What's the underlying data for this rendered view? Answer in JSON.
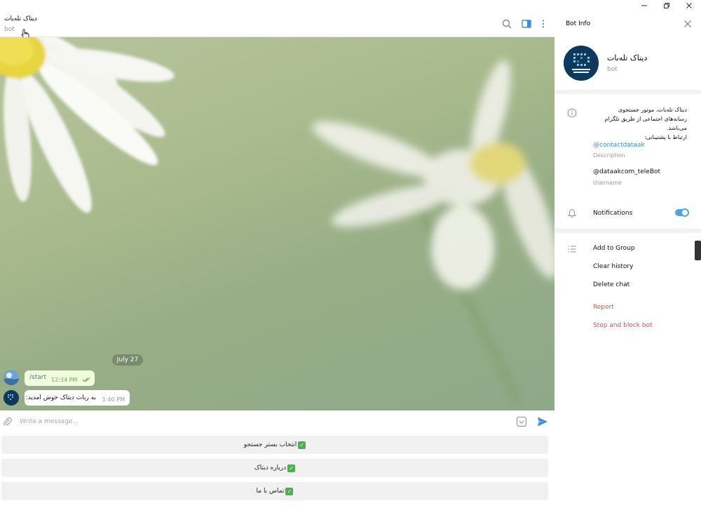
{
  "chat": {
    "title": "دیتاک تله‌بات",
    "subtitle": "bot",
    "date_pill": "July 27",
    "messages": [
      {
        "text": "/start",
        "time": "12:34 PM",
        "outgoing": true
      },
      {
        "text": "به ربات دیتاک خوش امدید:",
        "time": "1:40 PM",
        "outgoing": false
      }
    ],
    "composer_placeholder": "Write a message...",
    "keyboard": [
      {
        "label": "انتخاب بستر جستجو"
      },
      {
        "label": "درباره دیتاک"
      },
      {
        "label": "تماس با ما"
      }
    ]
  },
  "panel": {
    "title": "Bot Info",
    "bot_name": "دیتاک تله‌بات",
    "bot_sub": "bot",
    "description_lines": [
      "دیتاک تله‌بات، موتور جستجوی",
      "رسانه‌های اجتماعی از طریق تلگرام",
      "می‌باشد.",
      "ارتباط با پشتیبانی:"
    ],
    "contact_link": "@contactdataak",
    "description_label": "Description",
    "username": "@dataakcom_teleBot",
    "username_label": "Username",
    "notifications_label": "Notifications",
    "notifications_on": true,
    "actions": [
      {
        "label": "Add to Group"
      },
      {
        "label": "Clear history"
      },
      {
        "label": "Delete chat"
      }
    ],
    "danger_actions": [
      {
        "label": "Report"
      },
      {
        "label": "Stop and block bot"
      }
    ]
  },
  "colors": {
    "accent": "#4ea4e8",
    "danger": "#d9534f",
    "out_bubble": "#effdde"
  }
}
